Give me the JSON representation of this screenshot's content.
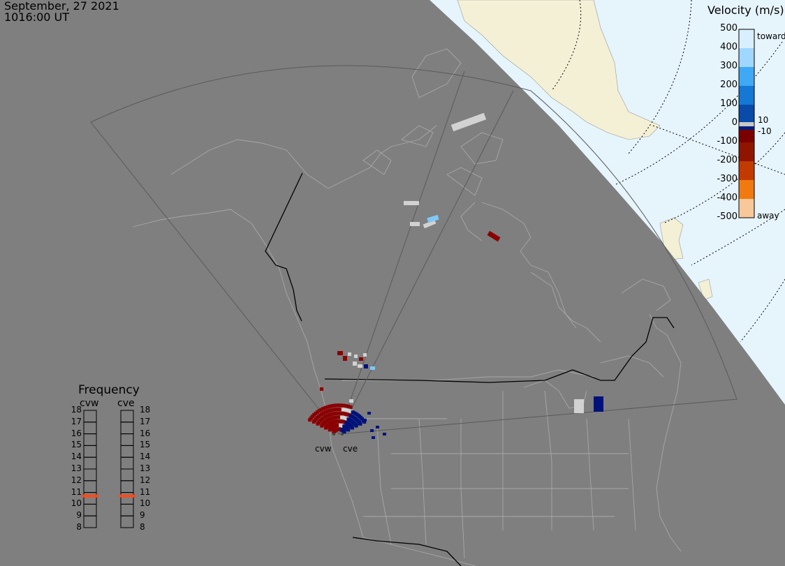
{
  "header": {
    "date": "September, 27 2021",
    "time": "1016:00 UT"
  },
  "velocity_scale": {
    "title": "Velocity (m/s)",
    "ticks": [
      "500",
      "400",
      "300",
      "200",
      "100",
      "0",
      "-100",
      "-200",
      "-300",
      "-400",
      "-500"
    ],
    "toward_label": "toward",
    "away_label": "away",
    "ground_scatter_labels": [
      "10",
      "-10"
    ],
    "colors": [
      "#d9efff",
      "#9fd7ff",
      "#3fa9f5",
      "#1478d4",
      "#0a4aa8",
      "#001f7a",
      "#7a0000",
      "#8f1500",
      "#c23a00",
      "#f07a10",
      "#f8c89a"
    ],
    "ground_scatter_color": "#c8c8c8"
  },
  "frequency_panel": {
    "title": "Frequency",
    "columns": [
      {
        "radar": "cvw",
        "value_mhz": 10.7
      },
      {
        "radar": "cve",
        "value_mhz": 10.7
      }
    ],
    "ticks": [
      "18",
      "17",
      "16",
      "15",
      "14",
      "13",
      "12",
      "11",
      "10",
      "9",
      "8"
    ],
    "indicator_color": "#ff4a1a"
  },
  "radars": [
    {
      "name": "cvw"
    },
    {
      "name": "cve"
    }
  ],
  "map_colors": {
    "background": "#7f7f7f",
    "daylight_ocean": "#e6f4fc",
    "daylight_land": "#f4f0d6",
    "borders": "#a8a8a8",
    "political_border": "#000000"
  }
}
